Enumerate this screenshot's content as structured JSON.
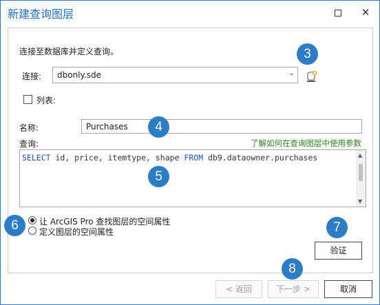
{
  "window": {
    "title": "新建查询图层",
    "maximize_icon": "maximize-icon",
    "close_icon": "close-icon"
  },
  "intro_text": "连接至数据库并定义查询。",
  "connection": {
    "label": "连接:",
    "value": "dbonly.sde",
    "dropdown_icon": "chevron-down-icon",
    "add_connection_icon": "database-add-icon"
  },
  "list_checkbox": {
    "label": "列表:",
    "checked": false
  },
  "name": {
    "label": "名称:",
    "value": "Purchases"
  },
  "query": {
    "label": "查询:",
    "help_link": "了解如何在查询图层中使用参数",
    "sql_keyword_select": "SELECT",
    "sql_fields": " id, price, itemtype, shape ",
    "sql_keyword_from": "FROM",
    "sql_table": " db9.dataowner.purchases"
  },
  "spatial_options": [
    {
      "label": "让 ArcGIS Pro 查找图层的空间属性",
      "selected": true
    },
    {
      "label": "定义图层的空间属性",
      "selected": false
    }
  ],
  "buttons": {
    "validate": "验证",
    "back": "< 返回",
    "next": "下一步 >",
    "cancel": "取消"
  },
  "callouts": [
    "3",
    "4",
    "5",
    "6",
    "7",
    "8"
  ],
  "colors": {
    "accent": "#1f73c6",
    "callout": "#2c7cc6",
    "link": "#2a8a1e",
    "sql_keyword": "#1e50d8"
  }
}
